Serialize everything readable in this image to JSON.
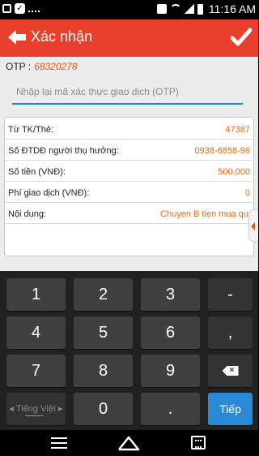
{
  "status_bar": {
    "time": "11:16 AM"
  },
  "header": {
    "title": "Xác nhận",
    "back_icon": "arrow-left-icon",
    "confirm_icon": "checkmark-icon"
  },
  "otp": {
    "label": "OTP :",
    "value": "68320278",
    "input_placeholder": "Nhập lại mã xác thực giao dịch (OTP)",
    "input_value": ""
  },
  "details": [
    {
      "label": "Từ TK/Thẻ:",
      "value": "47387"
    },
    {
      "label": "Số ĐTDĐ người thụ hưởng:",
      "value": "0938-6858-96"
    },
    {
      "label": "Số tiền (VNĐ):",
      "value": "500,000"
    },
    {
      "label": "Phí giao dịch (VNĐ):",
      "value": "0"
    },
    {
      "label": "Nội dung:",
      "value": "Chuyen B tien mua qua"
    }
  ],
  "keyboard": {
    "keys": {
      "k1": "1",
      "k2": "2",
      "k3": "3",
      "minus": "-",
      "k4": "4",
      "k5": "5",
      "k6": "6",
      "comma": ",",
      "k7": "7",
      "k8": "8",
      "k9": "9",
      "lang": "◂ Tiếng Việt ▸",
      "k0": "0",
      "dot": ".",
      "next": "Tiếp"
    },
    "backspace_icon": "backspace-icon"
  },
  "colors": {
    "header": "#e9402e",
    "accent_value": "#ee6a12",
    "input_underline": "#1a87c6",
    "next_key": "#2a8ad8"
  }
}
